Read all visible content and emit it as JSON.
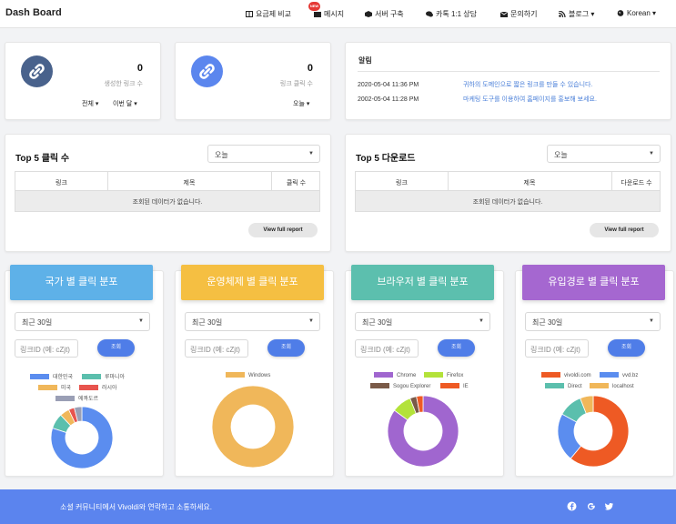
{
  "app": {
    "brand": "Dash Board"
  },
  "nav": {
    "pricing": "요금제 비교",
    "message": "메시지",
    "message_badge": "NEW",
    "server": "서버 구축",
    "kakao": "카톡 1:1 상담",
    "contact": "문의하기",
    "blog": "블로그",
    "language": "Korean"
  },
  "stats": {
    "created_links": {
      "value": "0",
      "label": "생성한 링크 수",
      "filter1": "전체",
      "filter2": "이번 달"
    },
    "link_clicks": {
      "value": "0",
      "label": "링크 클릭 수",
      "filter": "오늘"
    }
  },
  "notice": {
    "title": "알림",
    "items": [
      {
        "date": "2020-05-04 11:36 PM",
        "message": "귀하의 도메인으로 짧은 링크를 만들 수 있습니다."
      },
      {
        "date": "2002-05-04 11:28 PM",
        "message": "마케팅 도구를 이용하여 홈페이지를 홍보해 보세요."
      }
    ]
  },
  "top5_clicks": {
    "title": "Top 5 클릭 수",
    "period": "오늘",
    "columns": [
      "링크",
      "제목",
      "클릭 수"
    ],
    "empty": "조회된 데이터가 없습니다.",
    "report": "View full report"
  },
  "top5_downloads": {
    "title": "Top 5 다운로드",
    "period": "오늘",
    "columns": [
      "링크",
      "제목",
      "다운로드 수"
    ],
    "empty": "조회된 데이터가 없습니다.",
    "report": "View full report"
  },
  "distributions": [
    {
      "title": "국가 별 클릭 분포",
      "color": "#5eb1e8",
      "period": "최근 30일",
      "input_placeholder": "링크ID (예: cZjt)",
      "button": "조회",
      "legend": [
        {
          "label": "대한민국",
          "color": "#5b8def"
        },
        {
          "label": "루마니아",
          "color": "#5bbfad"
        },
        {
          "label": "미국",
          "color": "#f0b75a"
        },
        {
          "label": "러시아",
          "color": "#e8544e"
        },
        {
          "label": "에콰도르",
          "color": "#9a9fb5"
        }
      ],
      "chart_data": {
        "type": "pie",
        "labels": [
          "대한민국",
          "루마니아",
          "미국",
          "러시아",
          "에콰도르"
        ],
        "values": [
          80,
          8,
          5,
          3,
          4
        ],
        "colors": [
          "#5b8def",
          "#5bbfad",
          "#f0b75a",
          "#e8544e",
          "#9a9fb5"
        ]
      }
    },
    {
      "title": "운영체제 별 클릭 분포",
      "color": "#f5bf42",
      "period": "최근 30일",
      "input_placeholder": "링크ID (예: cZjt)",
      "button": "조회",
      "legend": [
        {
          "label": "Windows",
          "color": "#f0b75a"
        }
      ],
      "chart_data": {
        "type": "pie",
        "labels": [
          "Windows"
        ],
        "values": [
          100
        ],
        "colors": [
          "#f0b75a"
        ]
      }
    },
    {
      "title": "브라우저 별 클릭 분포",
      "color": "#5cbfae",
      "period": "최근 30일",
      "input_placeholder": "링크ID (예: cZjt)",
      "button": "조회",
      "legend": [
        {
          "label": "Chrome",
          "color": "#a066cf"
        },
        {
          "label": "Firefox",
          "color": "#b3e23a"
        },
        {
          "label": "Sogou Explorer",
          "color": "#7a5a48"
        },
        {
          "label": "IE",
          "color": "#ee5a24"
        }
      ],
      "chart_data": {
        "type": "pie",
        "labels": [
          "Chrome",
          "Firefox",
          "Sogou Explorer",
          "IE"
        ],
        "values": [
          85,
          9,
          3,
          3
        ],
        "colors": [
          "#a066cf",
          "#b3e23a",
          "#7a5a48",
          "#ee5a24"
        ]
      }
    },
    {
      "title": "유입경로 별 클릭 분포",
      "color": "#a567d0",
      "period": "최근 30일",
      "input_placeholder": "링크ID (예: cZjt)",
      "button": "조회",
      "legend": [
        {
          "label": "vivoldi.com",
          "color": "#ee5a24"
        },
        {
          "label": "vvd.bz",
          "color": "#5b8def"
        },
        {
          "label": "Direct",
          "color": "#5bbfad"
        },
        {
          "label": "localhost",
          "color": "#f0b75a"
        }
      ],
      "chart_data": {
        "type": "pie",
        "labels": [
          "vivoldi.com",
          "vvd.bz",
          "Direct",
          "localhost"
        ],
        "values": [
          61,
          22,
          11,
          6
        ],
        "colors": [
          "#ee5a24",
          "#5b8def",
          "#5bbfad",
          "#f0b75a"
        ]
      }
    }
  ],
  "footer": {
    "text": "소셜 커뮤니티에서 Vivoldi와 연락하고 소통하세요.",
    "social": [
      "facebook-icon",
      "google-icon",
      "twitter-icon"
    ]
  }
}
